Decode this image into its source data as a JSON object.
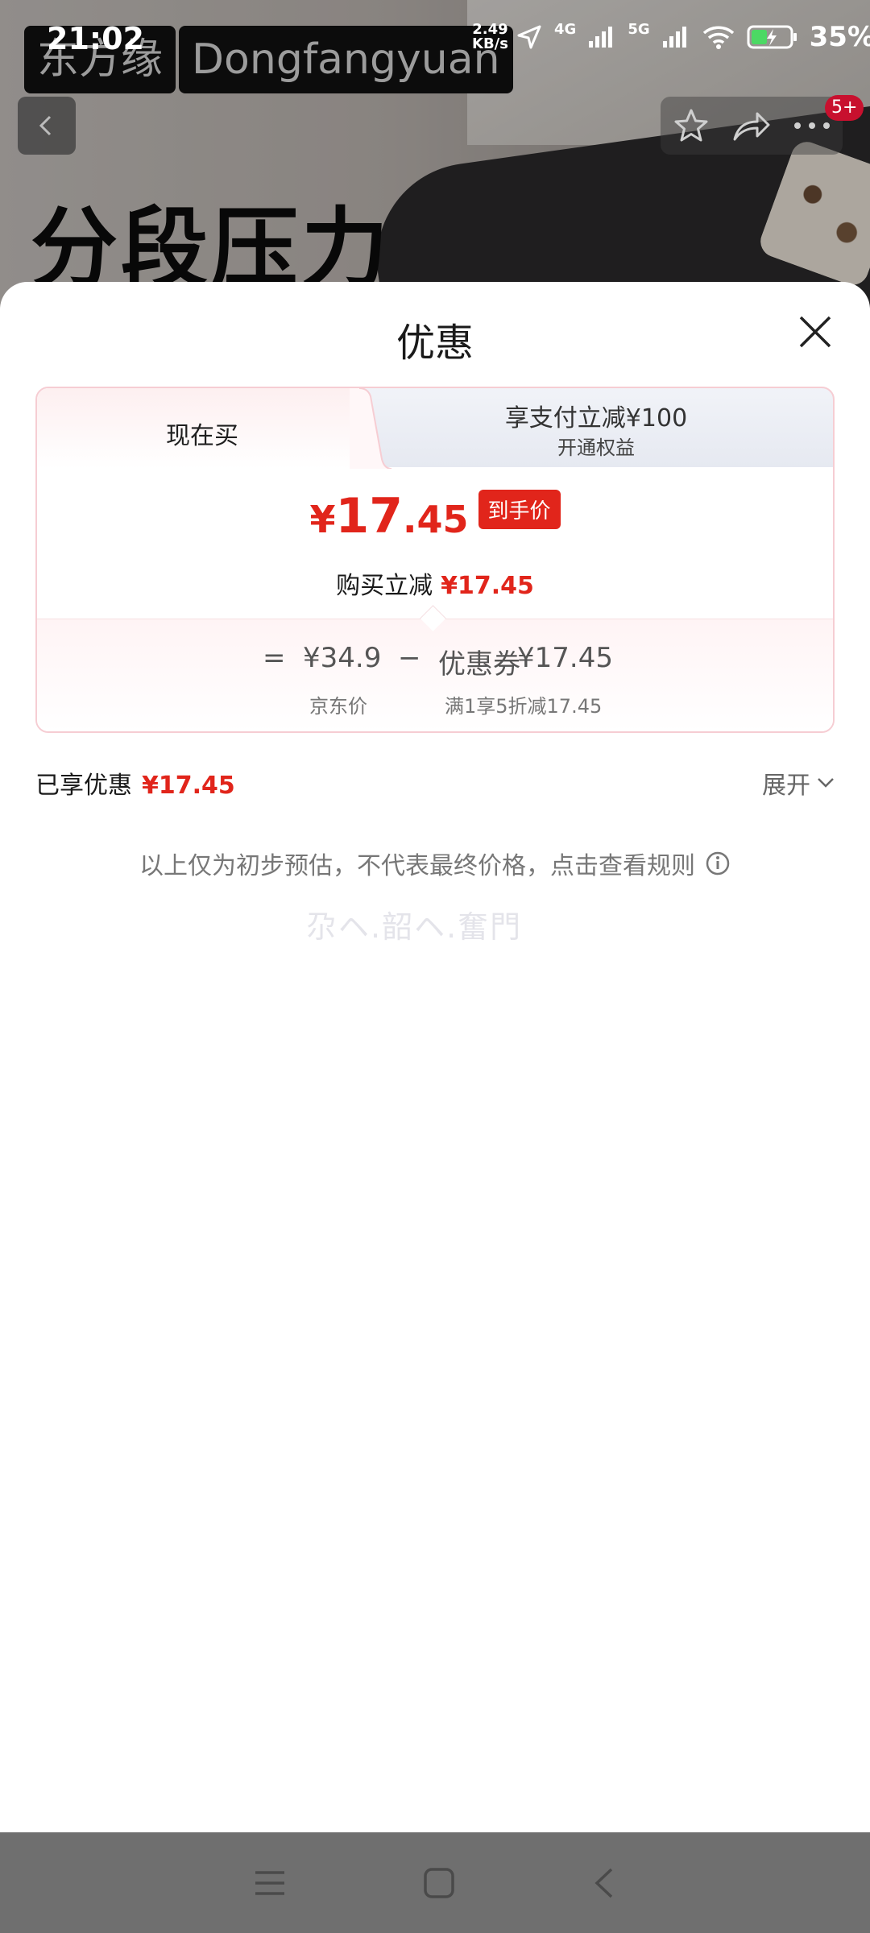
{
  "status_bar": {
    "time": "21:02",
    "net_speed": "2.49",
    "net_unit": "KB/s",
    "network_1": "4G",
    "network_2": "5G",
    "battery": "35%"
  },
  "background": {
    "brand_cn": "东方缘",
    "brand_en": "Dongfangyuan",
    "headline": "分段压力",
    "badge": "5+"
  },
  "sheet": {
    "title": "优惠",
    "tabs": {
      "active": "现在买",
      "other_title": "享支付立减¥100",
      "other_sub": "开通权益"
    },
    "price": {
      "sign": "¥",
      "integer": "17",
      "decimal": ".45",
      "tag": "到手价"
    },
    "summary": {
      "label": "购买立减",
      "value": "¥17.45"
    },
    "formula": {
      "equals": "=",
      "base_price": "¥34.9",
      "base_label": "京东价",
      "minus": "−",
      "coupon_label": "优惠券",
      "coupon_value": "¥17.45",
      "coupon_desc": "满1享5折减17.45"
    },
    "enjoyed": {
      "label": "已享优惠",
      "value": "¥17.45",
      "expand": "展开"
    },
    "note": "以上仅为初步预估，不代表最终价格，点击查看规则",
    "watermark": "尕ヘ.韶ヘ.奮門"
  },
  "colors": {
    "accent_red": "#e1251b",
    "card_border": "#f6cdd3"
  }
}
